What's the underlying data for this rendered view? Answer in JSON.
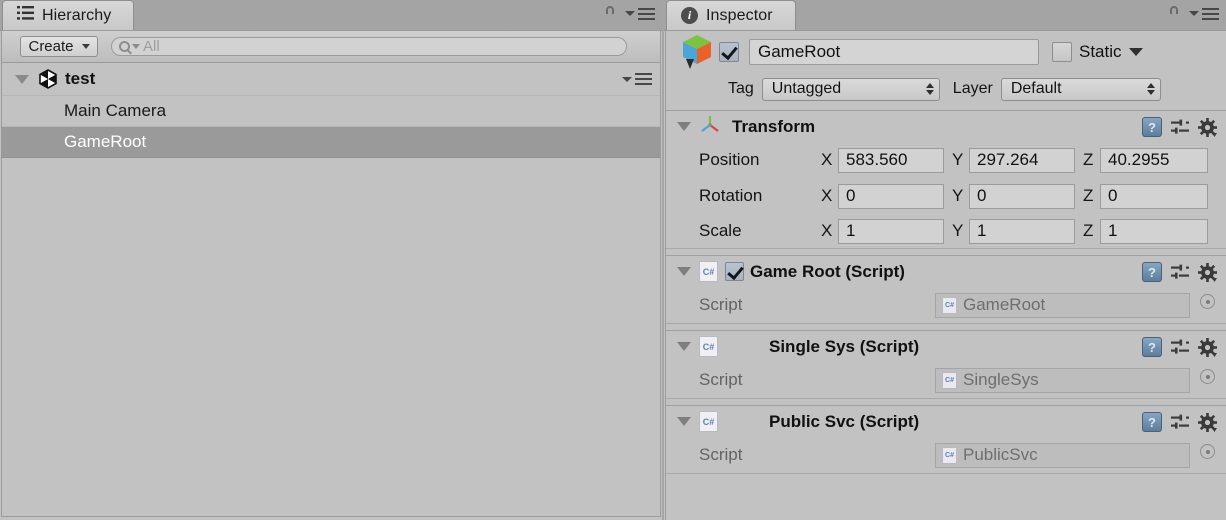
{
  "hierarchy": {
    "tab_label": "Hierarchy",
    "tab_icon": "hierarchy-list-icon",
    "lock_icon": "lock-open-icon",
    "menu_icon": "panel-menu-icon",
    "toolbar": {
      "create_label": "Create",
      "create_caret": "chevron-down-icon",
      "search_icon": "search-icon",
      "search_value": "All",
      "search_placeholder": "All"
    },
    "scene": {
      "name": "test",
      "icon": "unity-scene-icon",
      "expanded": true,
      "menu_icon": "scene-menu-icon"
    },
    "objects": [
      {
        "name": "Main Camera",
        "selected": false
      },
      {
        "name": "GameRoot",
        "selected": true
      }
    ]
  },
  "inspector": {
    "tab_label": "Inspector",
    "tab_icon": "info-icon",
    "lock_icon": "lock-open-icon",
    "menu_icon": "panel-menu-icon",
    "gameobject": {
      "icon": "gameobject-cube-icon",
      "enabled": true,
      "name": "GameRoot",
      "static_label": "Static",
      "static_checked": false,
      "static_caret": "chevron-down-icon",
      "tag_label": "Tag",
      "tag_value": "Untagged",
      "layer_label": "Layer",
      "layer_value": "Default"
    },
    "components": [
      {
        "title": "Transform",
        "icon": "transform-axis-icon",
        "expanded": true,
        "has_toggle": false,
        "type": "transform",
        "help_icon": "help-book-icon",
        "preset_icon": "preset-sliders-icon",
        "gear_icon": "gear-icon",
        "rows": [
          {
            "label": "Position",
            "x": "583.560",
            "y": "297.264",
            "z": "40.2955"
          },
          {
            "label": "Rotation",
            "x": "0",
            "y": "0",
            "z": "0"
          },
          {
            "label": "Scale",
            "x": "1",
            "y": "1",
            "z": "1"
          }
        ],
        "axis_labels": [
          "X",
          "Y",
          "Z"
        ]
      },
      {
        "title": "Game Root (Script)",
        "icon": "csharp-script-icon",
        "icon_text": "C#",
        "expanded": true,
        "has_toggle": true,
        "enabled": true,
        "type": "script",
        "help_icon": "help-book-icon",
        "preset_icon": "preset-sliders-icon",
        "gear_icon": "gear-icon",
        "script_label": "Script",
        "script_value": "GameRoot",
        "picker_icon": "object-picker-icon"
      },
      {
        "title": "Single Sys (Script)",
        "icon": "csharp-script-icon",
        "icon_text": "C#",
        "expanded": true,
        "has_toggle": false,
        "type": "script",
        "help_icon": "help-book-icon",
        "preset_icon": "preset-sliders-icon",
        "gear_icon": "gear-icon",
        "script_label": "Script",
        "script_value": "SingleSys",
        "picker_icon": "object-picker-icon"
      },
      {
        "title": "Public Svc (Script)",
        "icon": "csharp-script-icon",
        "icon_text": "C#",
        "expanded": true,
        "has_toggle": false,
        "type": "script",
        "help_icon": "help-book-icon",
        "preset_icon": "preset-sliders-icon",
        "gear_icon": "gear-icon",
        "script_label": "Script",
        "script_value": "PublicSvc",
        "picker_icon": "object-picker-icon"
      }
    ]
  },
  "colors": {
    "panel_bg": "#c2c2c2",
    "chrome_bg": "#a4a4a4",
    "selection": "#9a9a9a",
    "field_bg": "#d2d2d2",
    "text": "#141414",
    "muted_text": "#6e6e6e"
  }
}
